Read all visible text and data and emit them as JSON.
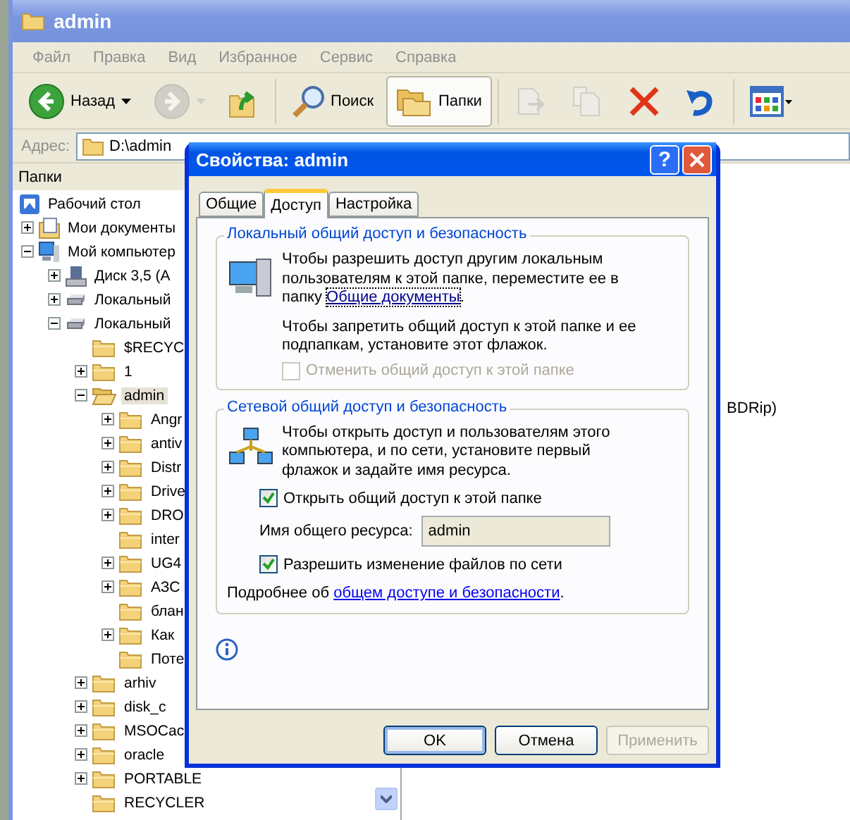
{
  "explorer": {
    "title": "admin",
    "menu": [
      "Файл",
      "Правка",
      "Вид",
      "Избранное",
      "Сервис",
      "Справка"
    ],
    "toolbar": [
      {
        "kind": "back",
        "label": "Назад",
        "disabled": false,
        "pressed": false
      },
      {
        "kind": "forward",
        "disabled": true,
        "pressed": false
      },
      {
        "kind": "up",
        "disabled": false,
        "pressed": false
      },
      {
        "kind": "search",
        "label": "Поиск",
        "disabled": false,
        "pressed": false
      },
      {
        "kind": "folders",
        "label": "Папки",
        "disabled": false,
        "pressed": true
      },
      {
        "kind": "move",
        "disabled": true,
        "pressed": false
      },
      {
        "kind": "copy",
        "disabled": true,
        "pressed": false
      },
      {
        "kind": "delete",
        "disabled": false,
        "pressed": false
      },
      {
        "kind": "undo",
        "disabled": false,
        "pressed": false
      },
      {
        "kind": "views",
        "disabled": false,
        "pressed": false
      }
    ],
    "address": {
      "label": "Адрес:",
      "value": "D:\\admin"
    },
    "folders_pane": {
      "title": "Папки",
      "tree": [
        {
          "label": "Рабочий стол",
          "kind": "desktop",
          "selected": false,
          "children": [
            {
              "label": "Мои документы",
              "kind": "documents",
              "expanded": false,
              "selected": false
            },
            {
              "label": "Мой компьютер",
              "kind": "computer",
              "expanded": true,
              "selected": false,
              "children": [
                {
                  "label": "Диск 3,5 (A",
                  "kind": "floppy",
                  "expanded": false,
                  "selected": false
                },
                {
                  "label": "Локальный",
                  "kind": "drive",
                  "expanded": false,
                  "selected": false
                },
                {
                  "label": "Локальный",
                  "kind": "drive",
                  "expanded": true,
                  "selected": false,
                  "children": [
                    {
                      "label": "$RECYC",
                      "kind": "folder",
                      "selected": false
                    },
                    {
                      "label": "1",
                      "kind": "folder",
                      "expanded": false,
                      "selected": false
                    },
                    {
                      "label": "admin",
                      "kind": "open-folder",
                      "expanded": true,
                      "selected": true,
                      "children": [
                        {
                          "label": "Angr",
                          "kind": "folder",
                          "expanded": false,
                          "selected": false
                        },
                        {
                          "label": "antiv",
                          "kind": "folder",
                          "expanded": false,
                          "selected": false
                        },
                        {
                          "label": "Distr",
                          "kind": "folder",
                          "expanded": false,
                          "selected": false
                        },
                        {
                          "label": "Drive",
                          "kind": "folder",
                          "expanded": false,
                          "selected": false
                        },
                        {
                          "label": "DRO",
                          "kind": "folder",
                          "expanded": false,
                          "selected": false
                        },
                        {
                          "label": "inter",
                          "kind": "folder",
                          "selected": false
                        },
                        {
                          "label": "UG4",
                          "kind": "folder",
                          "expanded": false,
                          "selected": false
                        },
                        {
                          "label": "АЗС",
                          "kind": "folder",
                          "expanded": false,
                          "selected": false
                        },
                        {
                          "label": "блан",
                          "kind": "folder",
                          "selected": false
                        },
                        {
                          "label": "Как",
                          "kind": "folder",
                          "expanded": false,
                          "selected": false
                        },
                        {
                          "label": "Поте",
                          "kind": "folder",
                          "selected": false
                        }
                      ]
                    },
                    {
                      "label": "arhiv",
                      "kind": "folder",
                      "expanded": false,
                      "selected": false
                    },
                    {
                      "label": "disk_c",
                      "kind": "folder",
                      "expanded": false,
                      "selected": false
                    },
                    {
                      "label": "MSOCac",
                      "kind": "folder",
                      "expanded": false,
                      "selected": false
                    },
                    {
                      "label": "oracle",
                      "kind": "folder",
                      "expanded": false,
                      "selected": false
                    },
                    {
                      "label": "PORTABLE",
                      "kind": "folder",
                      "expanded": false,
                      "selected": false
                    },
                    {
                      "label": "RECYCLER",
                      "kind": "folder",
                      "selected": false
                    }
                  ]
                }
              ]
            }
          ]
        }
      ]
    },
    "file_list": {
      "name_fragment": "BDRip)"
    }
  },
  "dialog": {
    "title": "Свойства: admin",
    "help_button": "?",
    "tabs": [
      {
        "label": "Общие",
        "selected": false
      },
      {
        "label": "Доступ",
        "selected": true
      },
      {
        "label": "Настройка",
        "selected": false
      }
    ],
    "local_group": {
      "legend": "Локальный общий доступ и безопасность",
      "text": {
        "before": "Чтобы разрешить доступ другим локальным пользователям к этой папке, переместите ее в папку ",
        "link": "Общие документы",
        "after": "."
      },
      "text2": "Чтобы запретить общий доступ к этой папке и ее подпапкам, установите этот флажок.",
      "checkbox": {
        "label": "Отменить общий доступ к этой папке",
        "checked": false,
        "disabled": true
      }
    },
    "network_group": {
      "legend": "Сетевой общий доступ и безопасность",
      "text": "Чтобы открыть доступ и пользователям этого компьютера, и по сети, установите первый флажок и задайте имя ресурса.",
      "share_checkbox": {
        "label": "Открыть общий доступ к этой папке",
        "checked": true,
        "disabled": false
      },
      "share_name": {
        "label": "Имя общего ресурса:",
        "value": "admin"
      },
      "write_checkbox": {
        "label": "Разрешить изменение файлов по сети",
        "checked": true,
        "disabled": false
      },
      "more": {
        "before": "Подробнее об ",
        "link": "общем доступе и безопасности",
        "after": "."
      }
    },
    "buttons": [
      {
        "label": "OK",
        "default": true,
        "disabled": false
      },
      {
        "label": "Отмена",
        "default": false,
        "disabled": false
      },
      {
        "label": "Применить",
        "default": false,
        "disabled": true
      }
    ]
  }
}
